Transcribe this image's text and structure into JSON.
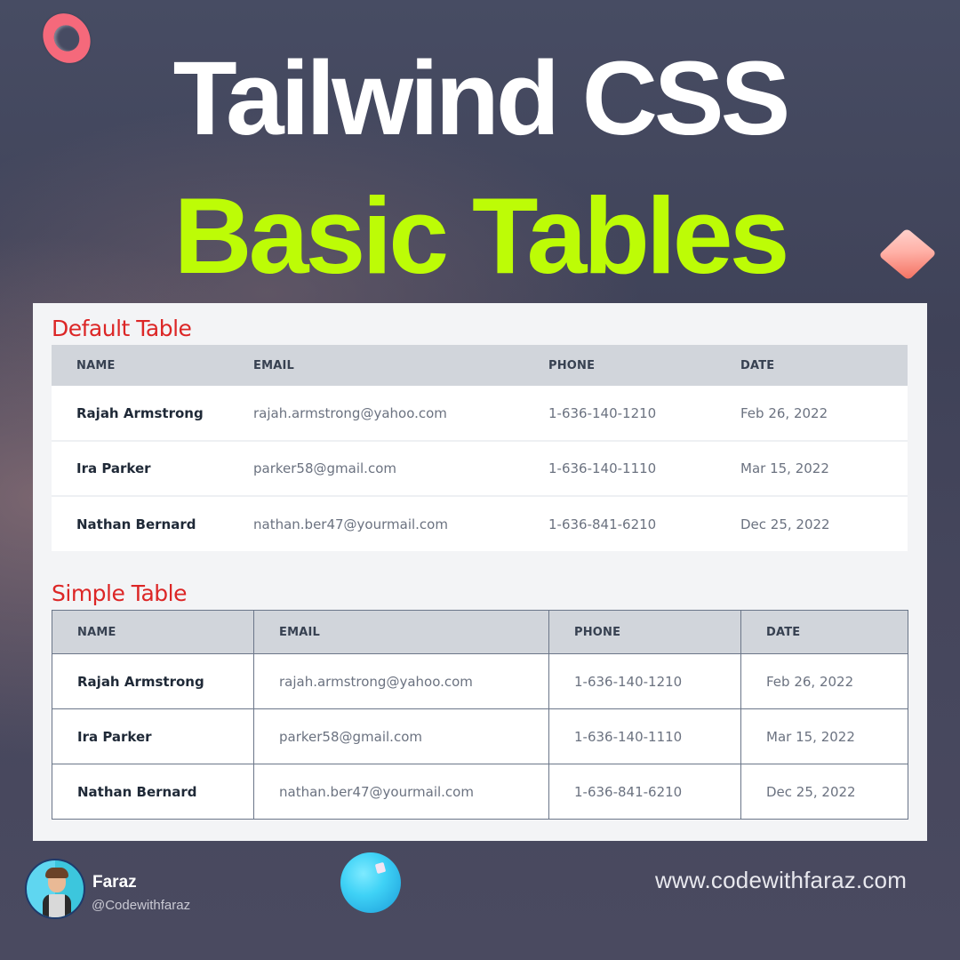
{
  "hero": {
    "line1": "Tailwind CSS",
    "line2": "Basic Tables"
  },
  "colors": {
    "hero_accent": "#bdfc06",
    "section_title": "#dc2626",
    "header_bg": "#d1d5db",
    "panel_bg": "#f3f4f6"
  },
  "default_table": {
    "title": "Default Table",
    "columns": [
      "NAME",
      "EMAIL",
      "PHONE",
      "DATE"
    ],
    "rows": [
      {
        "name": "Rajah Armstrong",
        "email": "rajah.armstrong@yahoo.com",
        "phone": "1-636-140-1210",
        "date": "Feb 26, 2022"
      },
      {
        "name": "Ira Parker",
        "email": "parker58@gmail.com",
        "phone": "1-636-140-1110",
        "date": "Mar 15, 2022"
      },
      {
        "name": "Nathan Bernard",
        "email": "nathan.ber47@yourmail.com",
        "phone": "1-636-841-6210",
        "date": "Dec 25, 2022"
      }
    ]
  },
  "simple_table": {
    "title": "Simple Table",
    "columns": [
      "NAME",
      "EMAIL",
      "PHONE",
      "DATE"
    ],
    "rows": [
      {
        "name": "Rajah Armstrong",
        "email": "rajah.armstrong@yahoo.com",
        "phone": "1-636-140-1210",
        "date": "Feb 26, 2022"
      },
      {
        "name": "Ira Parker",
        "email": "parker58@gmail.com",
        "phone": "1-636-140-1110",
        "date": "Mar 15, 2022"
      },
      {
        "name": "Nathan Bernard",
        "email": "nathan.ber47@yourmail.com",
        "phone": "1-636-841-6210",
        "date": "Dec 25, 2022"
      }
    ]
  },
  "footer": {
    "author_name": "Faraz",
    "author_handle": "@Codewithfaraz",
    "website": "www.codewithfaraz.com",
    "avatar_icon": "memoji-shrug-avatar"
  },
  "decorations": [
    "pink-torus-icon",
    "pink-cube-icon",
    "blue-sphere-icon"
  ]
}
